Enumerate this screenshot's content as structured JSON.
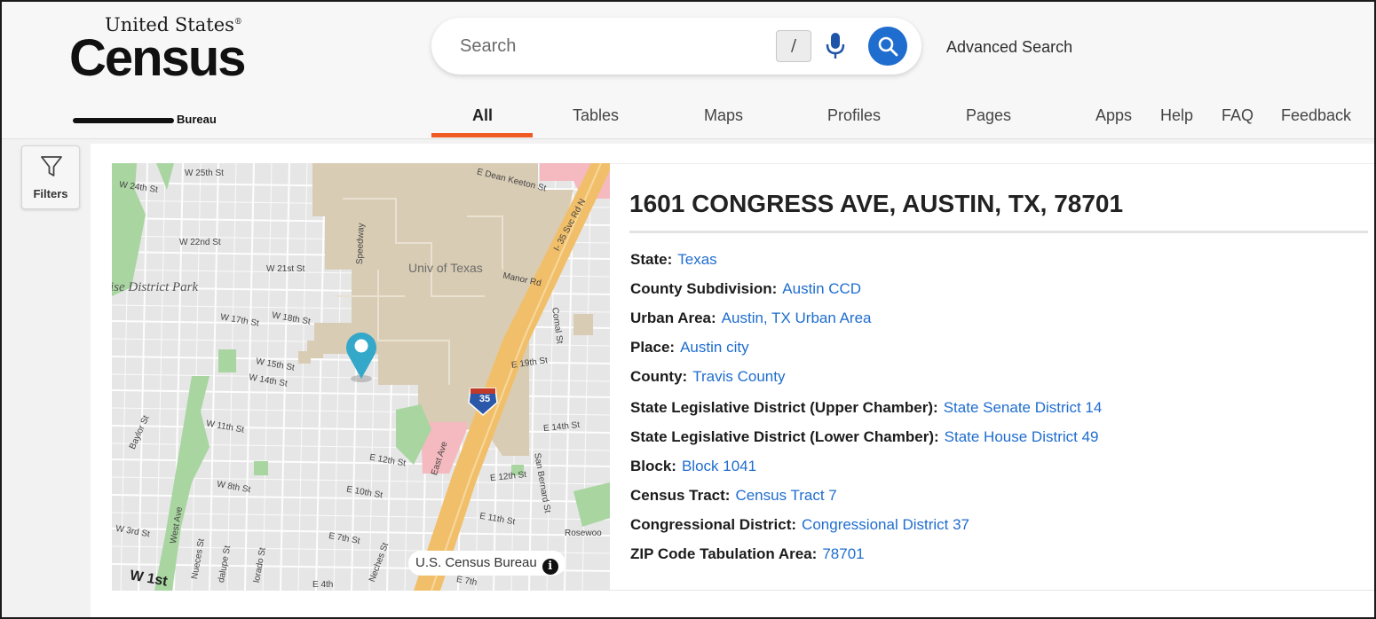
{
  "header": {
    "logo": {
      "top_text": "United States",
      "registered": "®",
      "main_text": "Census",
      "sub_text": "Bureau"
    },
    "search": {
      "placeholder": "Search",
      "shortcut_key": "/",
      "icons": [
        "microphone-icon",
        "search-icon"
      ]
    },
    "advanced_search_label": "Advanced Search",
    "nav": {
      "all": "All",
      "tables": "Tables",
      "maps": "Maps",
      "profiles": "Profiles",
      "pages": "Pages",
      "apps": "Apps",
      "help": "Help",
      "faq": "FAQ",
      "feedback": "Feedback",
      "active": "All"
    },
    "accent_color": "#f05a24"
  },
  "sidebar": {
    "filters_label": "Filters",
    "filters_icon": "filter-funnel-icon"
  },
  "map": {
    "labels": {
      "w25": "W 25th St",
      "w24": "W 24th St",
      "w22": "W 22nd St",
      "w21": "W 21st St",
      "park": "ise District Park",
      "w18": "W 18th St",
      "w17": "W 17th St",
      "w15": "W 15th St",
      "w14": "W 14th St",
      "w11": "W 11th St",
      "w8": "W 8th St",
      "w3": "W 3rd St",
      "w1": "W 1st",
      "univ": "Univ of Texas",
      "speedway": "Speedway",
      "manor": "Manor Rd",
      "dean": "E Dean Keeton St",
      "i35svc": "I- 35 Svc Rd N",
      "comal": "Comal St",
      "e19": "E 19th St",
      "e14": "E 14th St",
      "e12a": "E 12th St",
      "e12b": "E 12th St",
      "e10": "E 10th St",
      "e11": "E 11th St",
      "e7": "E 7th St",
      "e7b": "E 7th",
      "e4": "E 4th",
      "sanbernard": "San Bernard St",
      "eastave": "East Ave",
      "baylor": "Baylor St",
      "westave": "West Ave",
      "nueces": "Nueces St",
      "guadalupe": "dalupe St",
      "colorado": "lorado St",
      "neches": "Neches St",
      "rosewood": "Rosewoo",
      "shield": "35"
    },
    "attribution": "U.S. Census Bureau",
    "colors": {
      "background": "#e6e6e6",
      "campus": "#d9ccb4",
      "park": "#a8d5a0",
      "highway": "#f1bf6a",
      "pin": "#34a8c9",
      "hospital": "#f5b9c0"
    }
  },
  "details": {
    "title": "1601 CONGRESS AVE, AUSTIN, TX, 78701",
    "rows": [
      {
        "label": "State:",
        "value": "Texas"
      },
      {
        "label": "County Subdivision:",
        "value": "Austin CCD"
      },
      {
        "label": "Urban Area:",
        "value": "Austin, TX Urban Area"
      },
      {
        "label": "Place:",
        "value": "Austin city"
      },
      {
        "label": "County:",
        "value": "Travis County"
      },
      {
        "label": "State Legislative District (Upper Chamber):",
        "value": "State Senate District 14"
      },
      {
        "label": "State Legislative District (Lower Chamber):",
        "value": "State House District 49"
      },
      {
        "label": "Block:",
        "value": "Block 1041"
      },
      {
        "label": "Census Tract:",
        "value": "Census Tract 7"
      },
      {
        "label": "Congressional District:",
        "value": "Congressional District 37"
      },
      {
        "label": "ZIP Code Tabulation Area:",
        "value": "78701"
      }
    ],
    "link_color": "#1f6dce"
  }
}
